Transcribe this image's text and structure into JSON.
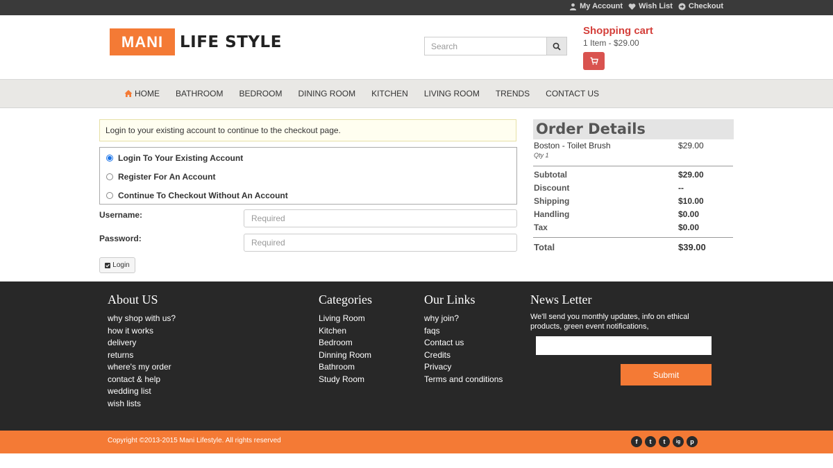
{
  "topbar": {
    "my_account": "My Account",
    "wish_list": "Wish List",
    "checkout": "Checkout"
  },
  "header": {
    "logo_box": "MANI",
    "logo_text": "LIFE STYLE",
    "search_placeholder": "Search",
    "cart_title": "Shopping cart",
    "cart_summary": "1 Item - $29.00"
  },
  "nav": [
    "HOME",
    "BATHROOM",
    "BEDROOM",
    "DINING ROOM",
    "KITCHEN",
    "LIVING ROOM",
    "TRENDS",
    "CONTACT US"
  ],
  "checkout": {
    "notice": "Login to your existing account to continue to the checkout page.",
    "options": [
      "Login To Your Existing Account",
      "Register For An Account",
      "Continue To Checkout Without An Account"
    ],
    "selected_option": 0,
    "username_label": "Username:",
    "password_label": "Password:",
    "username_placeholder": "Required",
    "password_placeholder": "Required",
    "login_button": "Login"
  },
  "order": {
    "title": "Order Details",
    "item_name": "Boston - Toilet Brush",
    "item_price": "$29.00",
    "item_qty": "Qty 1",
    "lines": [
      {
        "label": "Subtotal",
        "value": "$29.00"
      },
      {
        "label": "Discount",
        "value": "--"
      },
      {
        "label": "Shipping",
        "value": "$10.00"
      },
      {
        "label": "Handling",
        "value": "$0.00"
      },
      {
        "label": "Tax",
        "value": "$0.00"
      }
    ],
    "total_label": "Total",
    "total_value": "$39.00"
  },
  "footer": {
    "about": {
      "title": "About US",
      "links": [
        "why shop with us?",
        "how it works",
        "delivery",
        "returns",
        "where's my order",
        "contact & help",
        "wedding list",
        "wish lists"
      ]
    },
    "categories": {
      "title": "Categories",
      "links": [
        "Living Room",
        "Kitchen",
        "Bedroom",
        "Dinning Room",
        "Bathroom",
        "Study Room"
      ]
    },
    "our_links": {
      "title": "Our Links",
      "links": [
        "why join?",
        "faqs",
        "Contact us",
        "Credits",
        "Privacy",
        "Terms and conditions"
      ]
    },
    "newsletter": {
      "title": "News Letter",
      "description": "We'll send you monthly updates, info on ethical products, green event notifications,",
      "submit": "Submit"
    }
  },
  "bottom": {
    "copyright": "Copyright ©2013-2015 Mani Lifestyle. All rights reserved",
    "social": [
      "f",
      "t",
      "t",
      "ig",
      "p"
    ]
  },
  "colors": {
    "accent": "#f47a35",
    "cart_red": "#d9534f",
    "footer_bg": "#282828",
    "topbar_bg": "#3a3a3a"
  }
}
